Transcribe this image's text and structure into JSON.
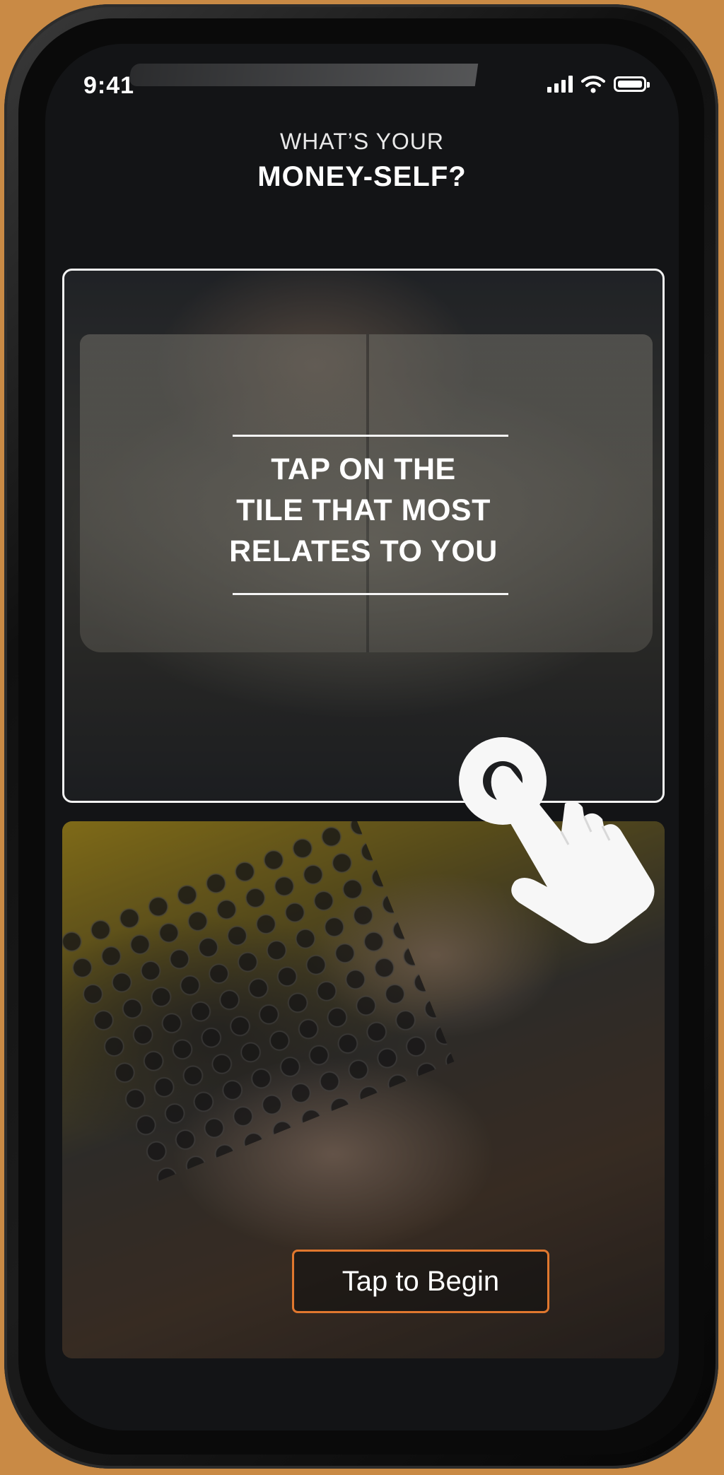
{
  "status_bar": {
    "time": "9:41",
    "signal_icon": "cellular-signal-icon",
    "wifi_icon": "wifi-icon",
    "battery_icon": "battery-icon"
  },
  "header": {
    "subtitle": "WHAT’S YOUR",
    "title": "MONEY-SELF?"
  },
  "tiles": [
    {
      "image": "open-book-photo",
      "lines": [
        "TAP ON THE",
        "TILE THAT MOST",
        "RELATES TO YOU"
      ],
      "selected": true
    },
    {
      "image": "typewriter-photo",
      "button_label": "Tap to Begin"
    }
  ],
  "tap_hint_icon": "tap-hand-icon",
  "colors": {
    "background": "#c98a45",
    "screen": "#131416",
    "button_border": "#e0772e",
    "text": "#ffffff"
  }
}
